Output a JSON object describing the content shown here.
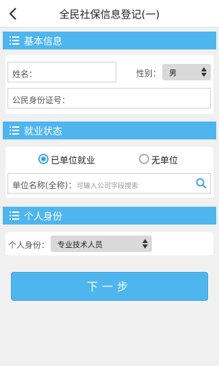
{
  "header": {
    "title": "全民社保信息登记(一)"
  },
  "basic": {
    "section_title": "基本信息",
    "name_label": "姓名：",
    "gender_label": "性别：",
    "gender_value": "男",
    "id_label": "公民身份证号："
  },
  "employment": {
    "section_title": "就业状态",
    "option_employed": "已单位就业",
    "option_unemployed": "无单位",
    "selected": "已单位就业",
    "company_label": "单位名称(全称)：",
    "company_placeholder": "可输入公司字段搜索"
  },
  "identity": {
    "section_title": "个人身份",
    "label": "个人身份：",
    "value": "专业技术人员"
  },
  "footer": {
    "next_label": "下一步"
  },
  "colors": {
    "accent": "#4fb5ef",
    "status_battery": "#3cb45a"
  },
  "icons": {
    "back": "chevron-left-icon",
    "list": "list-icon",
    "search": "search-icon"
  }
}
